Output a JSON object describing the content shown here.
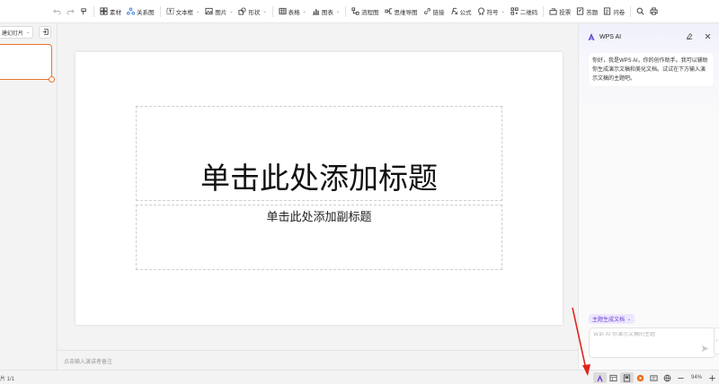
{
  "toolbar": {
    "items": [
      {
        "label": "素材",
        "icon": "material-icon"
      },
      {
        "label": "关系图",
        "icon": "relation-icon"
      },
      {
        "label": "文本框",
        "icon": "textbox-icon",
        "dropdown": true
      },
      {
        "label": "图片",
        "icon": "image-icon",
        "dropdown": true
      },
      {
        "label": "形状",
        "icon": "shape-icon",
        "dropdown": true
      },
      {
        "label": "表格",
        "icon": "table-icon",
        "dropdown": true
      },
      {
        "label": "图表",
        "icon": "chart-icon",
        "dropdown": true
      },
      {
        "label": "流程图",
        "icon": "flowchart-icon"
      },
      {
        "label": "思维导图",
        "icon": "mindmap-icon"
      },
      {
        "label": "链接",
        "icon": "link-icon"
      },
      {
        "label": "公式",
        "icon": "formula-icon"
      },
      {
        "label": "符号",
        "icon": "symbol-icon",
        "dropdown": true
      },
      {
        "label": "二维码",
        "icon": "qrcode-icon"
      },
      {
        "label": "投票",
        "icon": "vote-icon"
      },
      {
        "label": "答题",
        "icon": "quiz-icon"
      },
      {
        "label": "问卷",
        "icon": "survey-icon"
      }
    ]
  },
  "thumbs": {
    "new_slide_label": "建幻灯片"
  },
  "slide": {
    "title_placeholder": "单击此处添加标题",
    "subtitle_placeholder": "单击此处添加副标题"
  },
  "notes": {
    "placeholder": "点击输入演讲者备注"
  },
  "ai": {
    "title": "WPS AI",
    "greeting": "你好，我是WPS AI，你的创作助手。我可以辅助你生成演示文稿和美化文档。试试在下方输入演示文稿的主题吧。",
    "chip_label": "主题生成文档",
    "input_placeholder": "告诉 AI 你演示文稿的主题"
  },
  "status": {
    "slide_count": "片 1/1",
    "zoom": "94%"
  },
  "colors": {
    "accent_orange": "#e8772e",
    "ai_purple": "#6b3fd4",
    "annotation_red": "#e0241c"
  }
}
